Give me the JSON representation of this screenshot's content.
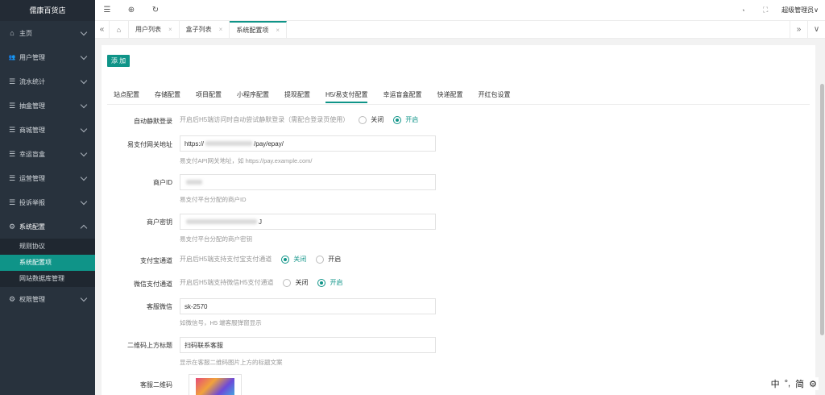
{
  "app": {
    "brand": "儒康百货店"
  },
  "sidebar": {
    "items": [
      {
        "icon": "⌂",
        "label": "主页"
      },
      {
        "icon": "👥",
        "label": "用户管理"
      },
      {
        "icon": "☰",
        "label": "流水统计"
      },
      {
        "icon": "☰",
        "label": "抽盒管理"
      },
      {
        "icon": "☰",
        "label": "商城管理"
      },
      {
        "icon": "☰",
        "label": "幸运盲盒"
      },
      {
        "icon": "☰",
        "label": "运营管理"
      },
      {
        "icon": "☰",
        "label": "投诉举报"
      },
      {
        "icon": "⚙",
        "label": "系统配置"
      },
      {
        "icon": "⚙",
        "label": "权限管理"
      }
    ],
    "sub_items": [
      "规则协议",
      "系统配置项",
      "网站数据库管理"
    ]
  },
  "topbar": {
    "icons": [
      "☰",
      "⊕",
      "↻"
    ],
    "right_icons": [
      "◔",
      "⛶"
    ],
    "user": "超级管理员∨"
  },
  "tabs": {
    "items": [
      "用户列表",
      "盒子列表",
      "系统配置项"
    ],
    "close": "×",
    "left_nav": "«",
    "home": "⌂",
    "right_nav": "»",
    "dropdown": "∨"
  },
  "main": {
    "add_label": "添 加",
    "subtabs": [
      "站点配置",
      "存储配置",
      "项目配置",
      "小程序配置",
      "提现配置",
      "H5/易支付配置",
      "幸运盲盒配置",
      "快递配置",
      "开红包设置"
    ],
    "form": {
      "auto_login": {
        "label": "自动静默登录",
        "desc": "开启后H5端访问时自动尝试静默登录（需配合登录页使用）",
        "off": "关闭",
        "on": "开启"
      },
      "gateway": {
        "label": "易支付网关地址",
        "value_prefix": "https://",
        "value_suffix": "/pay/epay/",
        "hint": "易支付API网关地址，如 https://pay.example.com/"
      },
      "merchant_id": {
        "label": "商户ID",
        "hint": "易支付平台分配的商户ID"
      },
      "merchant_key": {
        "label": "商户密钥",
        "value_suffix": "J",
        "hint": "易支付平台分配的商户密钥"
      },
      "alipay": {
        "label": "支付宝通道",
        "desc": "开启后H5端支持支付宝支付通道",
        "off": "关闭",
        "on": "开启"
      },
      "wechat": {
        "label": "微信支付通道",
        "desc": "开启后H5端支持微信H5支付通道",
        "off": "关闭",
        "on": "开启"
      },
      "service_wechat": {
        "label": "客服微信",
        "value": "sk-2570",
        "hint": "如微信号，H5 端客服弹窗显示"
      },
      "qr_title": {
        "label": "二维码上方标题",
        "value": "扫码联系客服",
        "hint": "显示在客服二维码图片上方的标题文案"
      },
      "qr_code": {
        "label": "客服二维码"
      }
    }
  },
  "ime": {
    "items": [
      "中",
      "°,",
      "简",
      "⚙"
    ]
  },
  "colors": {
    "accent": "#0f9488",
    "sidebar": "#28323d"
  }
}
